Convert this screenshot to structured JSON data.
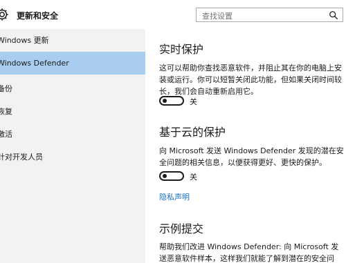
{
  "header": {
    "title": "更新和安全",
    "search_placeholder": "查找设置"
  },
  "sidebar": {
    "items": [
      {
        "label": "Windows 更新"
      },
      {
        "label": "Windows Defender"
      },
      {
        "label": "备份"
      },
      {
        "label": "恢复"
      },
      {
        "label": "激活"
      },
      {
        "label": "针对开发人员"
      }
    ],
    "selected_index": 1
  },
  "main": {
    "realtime": {
      "heading": "实时保护",
      "description": "这可以帮助你查找恶意软件，并阻止其在你的电脑上安装或运行。你可以短暂关闭此功能，但如果关闭时间较长，我们会自动重新启用它。",
      "toggle_state": "关"
    },
    "cloud": {
      "heading": "基于云的保护",
      "description": "向 Microsoft 发送 Windows Defender 发现的潜在安全问题的相关信息，以便获得更好、更快的保护。",
      "toggle_state": "关",
      "privacy_link": "隐私声明"
    },
    "sample": {
      "heading": "示例提交",
      "description": "帮助我们改进 Windows Defender: 向 Microsoft 发送恶意软件样本，这样我们就能了解到潜在的安全问题，"
    }
  },
  "colors": {
    "selected_bg": "#a9cdee",
    "sidebar_bg": "#f2f2f2",
    "link": "#1a6fc4"
  },
  "icons": {
    "app": "gear-icon",
    "search": "search-icon"
  }
}
